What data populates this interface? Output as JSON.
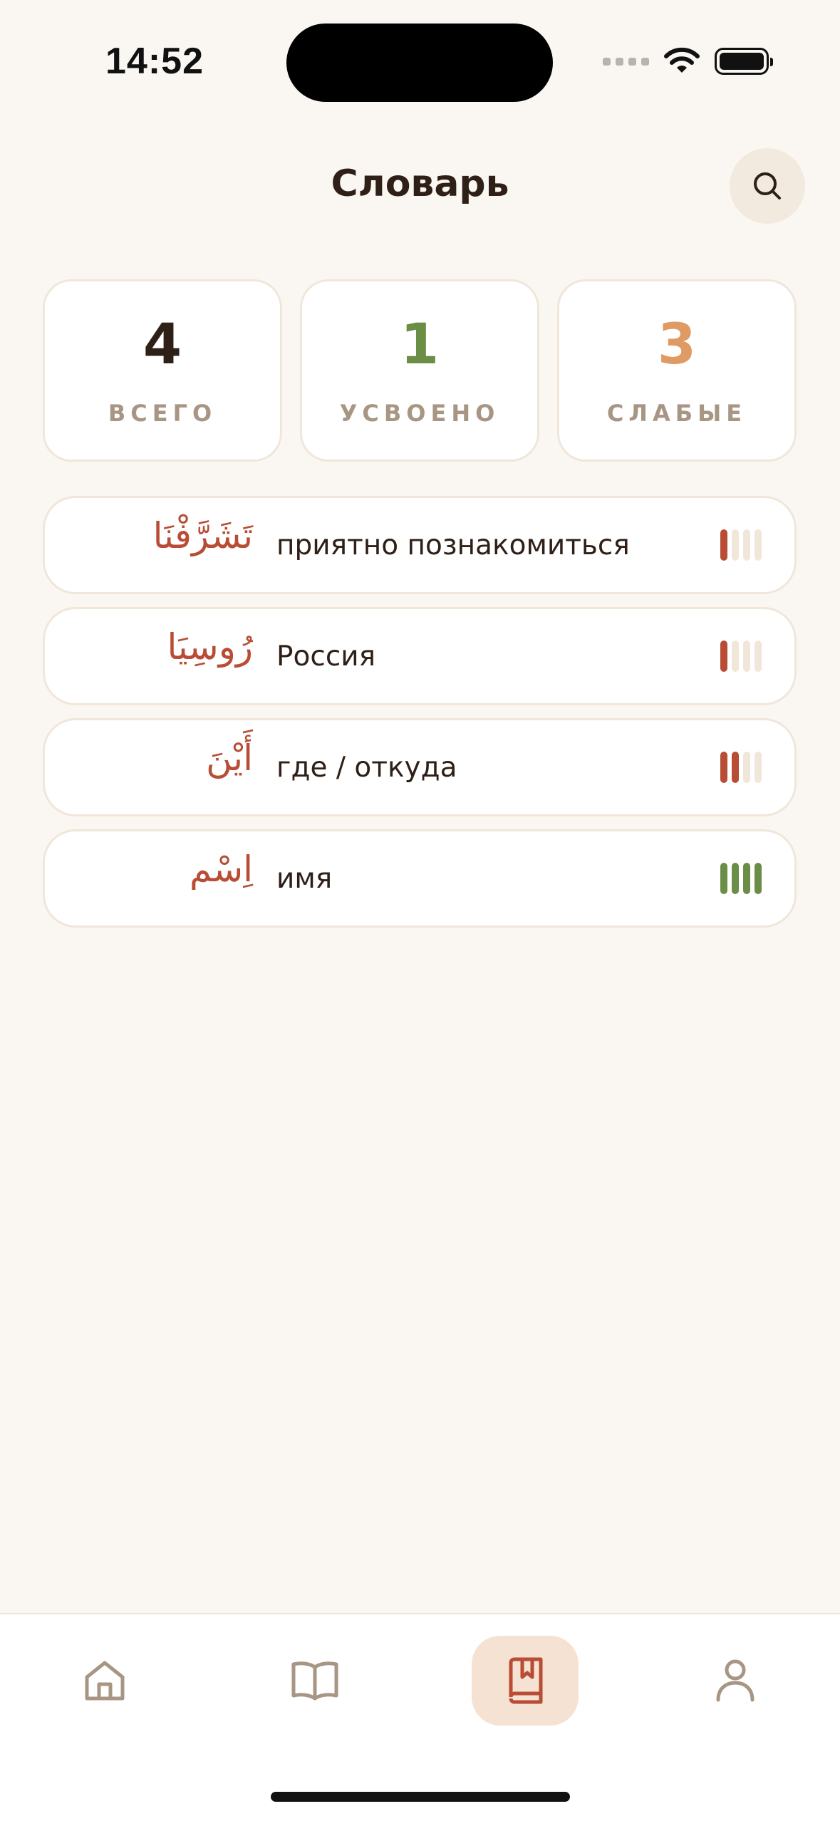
{
  "status_bar": {
    "time": "14:52"
  },
  "header": {
    "title": "Словарь"
  },
  "stats": [
    {
      "value": "4",
      "label": "ВСЕГО",
      "color": "#2E1F17"
    },
    {
      "value": "1",
      "label": "УСВОЕНО",
      "color": "#6B8E46"
    },
    {
      "value": "3",
      "label": "СЛАБЫЕ",
      "color": "#E09A63"
    }
  ],
  "words": [
    {
      "arabic": "تَشَرَّفْنَا",
      "translation": "приятно познакомиться",
      "mastery": 1,
      "mastery_max": 4,
      "mastery_color": "#B84C34"
    },
    {
      "arabic": "رُوسِيَا",
      "translation": "Россия",
      "mastery": 1,
      "mastery_max": 4,
      "mastery_color": "#B84C34"
    },
    {
      "arabic": "أَيْنَ",
      "translation": "где / откуда",
      "mastery": 2,
      "mastery_max": 4,
      "mastery_color": "#B84C34"
    },
    {
      "arabic": "اِسْم",
      "translation": "имя",
      "mastery": 4,
      "mastery_max": 4,
      "mastery_color": "#6B8E46"
    }
  ],
  "nav": {
    "items": [
      {
        "icon": "home-icon",
        "active": false
      },
      {
        "icon": "open-book-icon",
        "active": false
      },
      {
        "icon": "bookmark-book-icon",
        "active": true
      },
      {
        "icon": "profile-icon",
        "active": false
      }
    ],
    "active_color": "#B84C34",
    "inactive_color": "#A89684"
  }
}
